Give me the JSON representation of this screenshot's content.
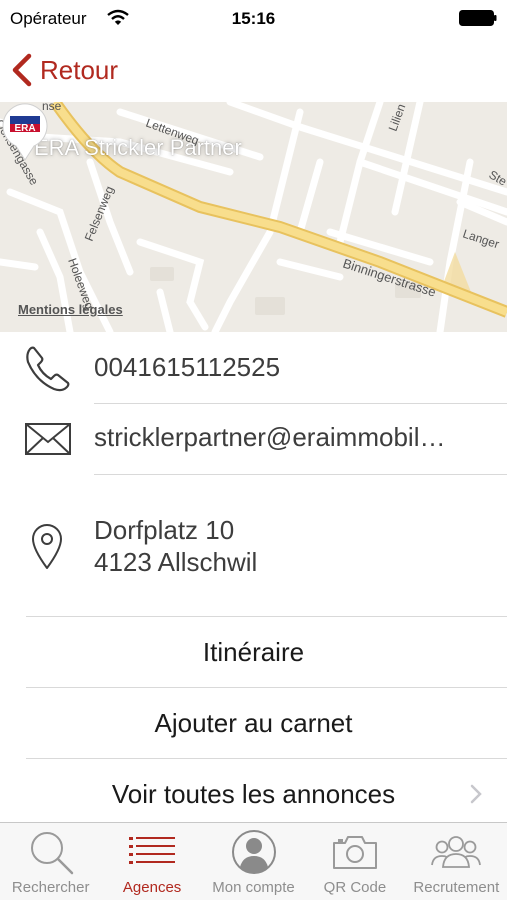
{
  "status_bar": {
    "carrier": "Opérateur",
    "time": "15:16"
  },
  "nav": {
    "back_label": "Retour"
  },
  "map": {
    "agency_title": "ERA Strickler Partner",
    "legal_link": "Mentions légales",
    "pin_logo": "ERA",
    "streets": [
      "Ochsengasse",
      "Lettenweg",
      "Felsenweg",
      "Holeeweg",
      "Binningerstrasse",
      "Lilien",
      "Langer",
      "Ste",
      "nse"
    ]
  },
  "contact": {
    "phone": "0041615112525",
    "email": "stricklerpartner@eraimmobil…",
    "address_line1": "Dorfplatz 10",
    "address_line2": "4123 Allschwil"
  },
  "actions": {
    "itinerary": "Itinéraire",
    "add_contact": "Ajouter au carnet",
    "all_listings": "Voir toutes les annonces"
  },
  "tabs": [
    {
      "label": "Rechercher",
      "icon": "search-icon",
      "active": false
    },
    {
      "label": "Agences",
      "icon": "list-icon",
      "active": true
    },
    {
      "label": "Mon compte",
      "icon": "user-icon",
      "active": false
    },
    {
      "label": "QR Code",
      "icon": "camera-icon",
      "active": false
    },
    {
      "label": "Recrutement",
      "icon": "group-icon",
      "active": false
    }
  ],
  "colors": {
    "accent": "#b1291f",
    "major_road": "#f5d98a",
    "map_background": "#eeebe5"
  }
}
